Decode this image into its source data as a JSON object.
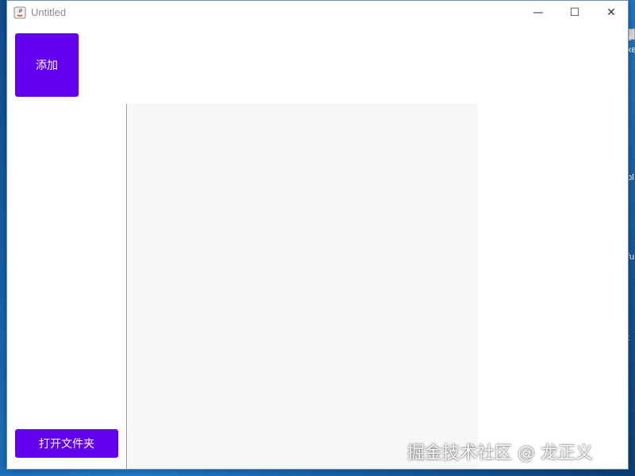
{
  "window": {
    "title": "Untitled",
    "controls": {
      "minimize": "—",
      "maximize": "☐",
      "close": "✕"
    }
  },
  "toolbar": {
    "add_label": "添加",
    "open_folder_label": "打开文件夹"
  },
  "watermark": "掘金技术社区 @ 龙正义",
  "desktop_fragments": [
    "e",
    "xe",
    "bl",
    "fu",
    "t"
  ],
  "colors": {
    "accent": "#6200ee",
    "panel_bg": "#f7f7f7",
    "window_bg": "#ffffff"
  },
  "icons": {
    "app_icon": "java-app-icon"
  }
}
